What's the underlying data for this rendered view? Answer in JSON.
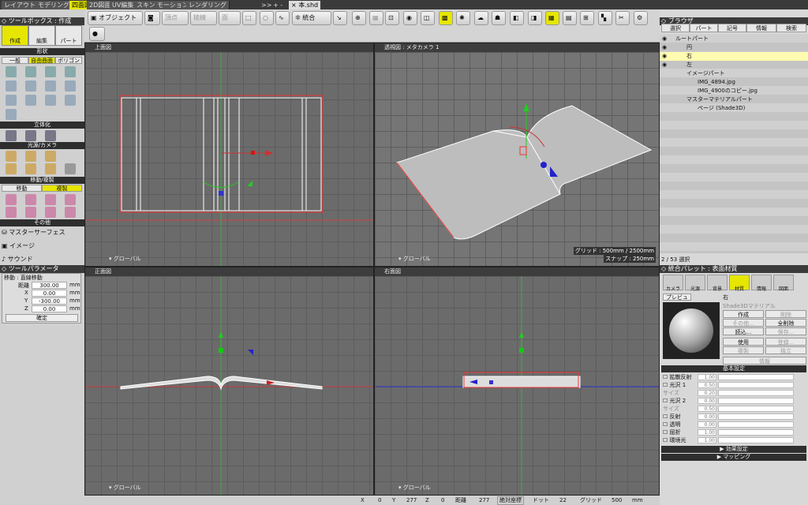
{
  "mode_tabs": [
    {
      "label": "レイアウト"
    },
    {
      "label": "モデリング"
    },
    {
      "label": "四面図",
      "active": true
    },
    {
      "label": "2D図面"
    },
    {
      "label": "UV編集"
    },
    {
      "label": "スキン"
    },
    {
      "label": "モーション"
    },
    {
      "label": "レンダリング"
    }
  ],
  "doc_tabs": {
    "more": ">>",
    "add": "+ -",
    "close": "×",
    "file": "本.shd"
  },
  "toolbar": {
    "object": "オブジェクト",
    "vertex": "頂点",
    "edge": "稜線",
    "face": "面",
    "integrate": "統合"
  },
  "toolbox": {
    "title": "ツールボックス : 作成",
    "create": "作成",
    "edit": "編集",
    "part": "パート",
    "shape": "形状",
    "general": "一般",
    "freeform": "自由曲面",
    "polygon": "ポリゴン",
    "solid": "立体化",
    "light_camera": "光源/カメラ",
    "move_copy": "移動/複製",
    "move": "移動",
    "copy": "複製",
    "other": "その他",
    "master_surface": "マスターサーフェス",
    "image": "イメージ",
    "sound": "サウンド"
  },
  "tool_params": {
    "title": "ツールパラメータ",
    "mode": "移動 : 直線移動",
    "dist_label": "距離",
    "dist": "300.00",
    "x": "0.00",
    "y": "-300.00",
    "z": "0.00",
    "unit": "mm",
    "ok": "確定"
  },
  "viewports": {
    "top": "上面図",
    "persp": "透視図 : メタカメラ 1",
    "front": "正面図",
    "right": "右面図",
    "global": "グローバル",
    "grid": "グリッド : 500mm / 2500mm",
    "snap": "スナップ : 250mm"
  },
  "browser": {
    "title": "ブラウザ",
    "tabs": [
      "選択",
      "パート",
      "記号",
      "情報",
      "検索"
    ],
    "items": [
      {
        "label": "ルートパート",
        "indent": 20
      },
      {
        "label": "円",
        "indent": 34
      },
      {
        "label": "右",
        "indent": 34,
        "sel": true
      },
      {
        "label": "左",
        "indent": 34
      },
      {
        "label": "イメージパート",
        "indent": 34
      },
      {
        "label": "IMG_4894.jpg",
        "indent": 48
      },
      {
        "label": "IMG_4900のコピー.jpg",
        "indent": 48
      },
      {
        "label": "マスターマテリアルパート",
        "indent": 34
      },
      {
        "label": "ページ (Shade3D)",
        "indent": 48
      }
    ],
    "count": "2 / 53 選択"
  },
  "material": {
    "title": "統合パレット : 表面材質",
    "tabs": [
      "カメラ",
      "光源",
      "背景",
      "材質",
      "情報",
      "図面"
    ],
    "preview": "プレビュー",
    "part": "右",
    "mat_name": "Shade3Dマテリアル",
    "create": "作成",
    "delete": "削除",
    "other": "その他...",
    "delete_all": "全削除",
    "load": "読込...",
    "save": "保存...",
    "use": "使用",
    "register": "登録...",
    "copy": "複製",
    "independent": "独立",
    "info": "情報",
    "basic": "基本設定",
    "rows": [
      {
        "label": "拡散反射",
        "v": "1.00",
        "cb": true
      },
      {
        "label": "光沢 1",
        "v": "0.50",
        "cb": true
      },
      {
        "label": "サイズ",
        "v": "0.20",
        "cb": false
      },
      {
        "label": "光沢 2",
        "v": "0.00",
        "cb": true
      },
      {
        "label": "サイズ",
        "v": "0.50",
        "cb": false
      },
      {
        "label": "反射",
        "v": "0.00",
        "cb": true
      },
      {
        "label": "透明",
        "v": "0.00",
        "cb": true
      },
      {
        "label": "屈折",
        "v": "1.00",
        "cb": true
      },
      {
        "label": "環境光",
        "v": "1.00",
        "cb": true
      }
    ],
    "effects": "効果設定",
    "mapping": "マッピング"
  },
  "status": {
    "x": "0",
    "y": "277",
    "z": "0",
    "dist": "277",
    "coord": "絶対座標",
    "dot": "ドット",
    "dot_v": "22",
    "grid": "グリッド",
    "grid_v": "500",
    "unit": "mm"
  }
}
